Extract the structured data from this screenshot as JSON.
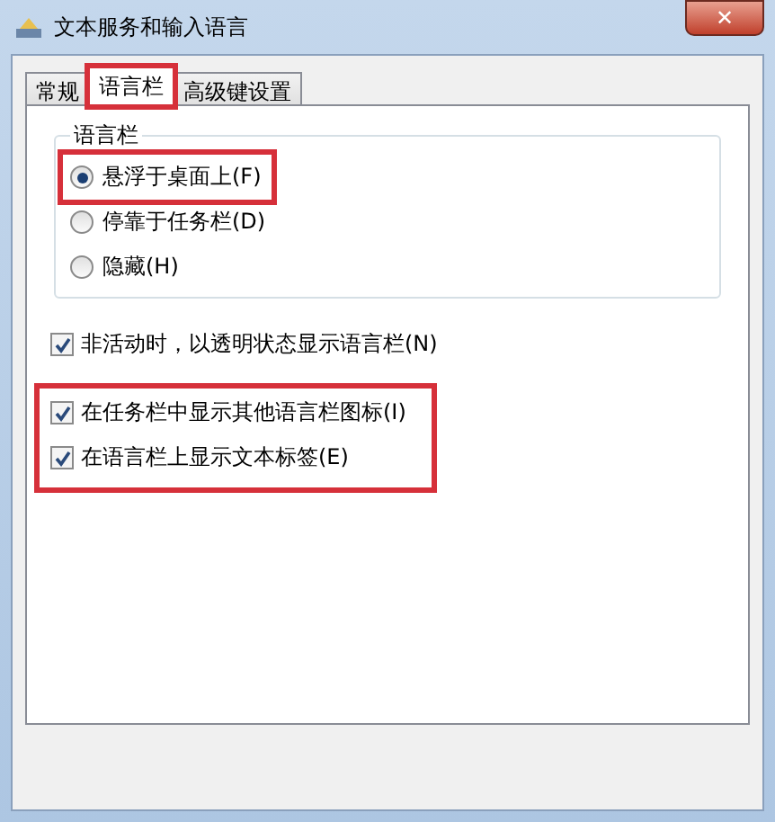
{
  "window": {
    "title": "文本服务和输入语言",
    "close": "✕"
  },
  "tabs": [
    {
      "label": "常规",
      "selected": false,
      "highlighted": false
    },
    {
      "label": "语言栏",
      "selected": true,
      "highlighted": true
    },
    {
      "label": "高级键设置",
      "selected": false,
      "highlighted": false
    }
  ],
  "language_bar_group": {
    "title": "语言栏",
    "options": [
      {
        "label": "悬浮于桌面上(F)",
        "selected": true,
        "highlighted": true
      },
      {
        "label": "停靠于任务栏(D)",
        "selected": false,
        "highlighted": false
      },
      {
        "label": "隐藏(H)",
        "selected": false,
        "highlighted": false
      }
    ]
  },
  "check_groups": [
    {
      "highlighted": false,
      "items": [
        {
          "label": "非活动时，以透明状态显示语言栏(N)",
          "checked": true
        }
      ]
    },
    {
      "highlighted": true,
      "items": [
        {
          "label": "在任务栏中显示其他语言栏图标(I)",
          "checked": true
        },
        {
          "label": "在语言栏上显示文本标签(E)",
          "checked": true
        }
      ]
    }
  ]
}
